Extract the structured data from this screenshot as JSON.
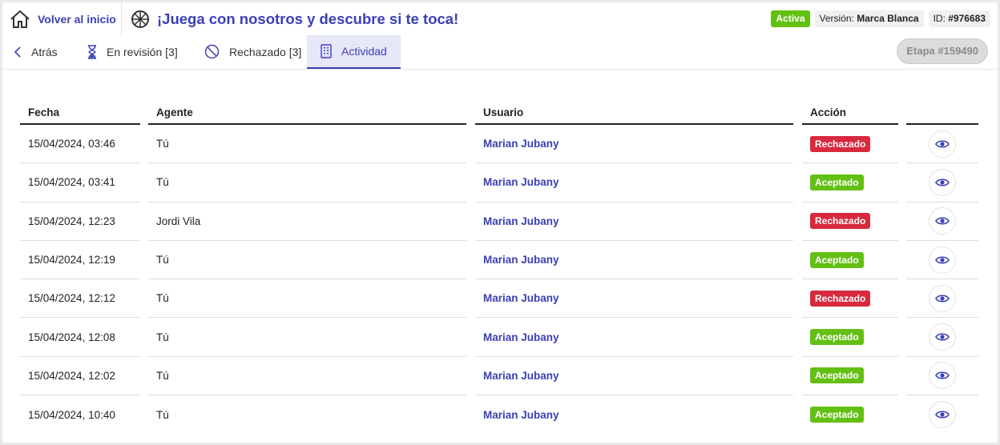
{
  "header": {
    "home_label": "Volver al inicio",
    "title": "¡Juega con nosotros y descubre si te toca!",
    "status": "Activa",
    "version_label": "Versión:",
    "version_value": "Marca Blanca",
    "id_label": "ID:",
    "id_value": "#976683"
  },
  "tabs": {
    "back": "Atrás",
    "review": "En revisión [3]",
    "rejected": "Rechazado [3]",
    "activity": "Actividad",
    "stage": "Etapa #159490"
  },
  "table": {
    "headers": {
      "fecha": "Fecha",
      "agente": "Agente",
      "usuario": "Usuario",
      "accion": "Acción"
    },
    "rows": [
      {
        "fecha": "15/04/2024, 03:46",
        "agente": "Tú",
        "usuario": "Marian Jubany",
        "accion": "Rechazado"
      },
      {
        "fecha": "15/04/2024, 03:41",
        "agente": "Tú",
        "usuario": "Marian Jubany",
        "accion": "Aceptado"
      },
      {
        "fecha": "15/04/2024, 12:23",
        "agente": "Jordi Vila",
        "usuario": "Marian Jubany",
        "accion": "Rechazado"
      },
      {
        "fecha": "15/04/2024, 12:19",
        "agente": "Tú",
        "usuario": "Marian Jubany",
        "accion": "Aceptado"
      },
      {
        "fecha": "15/04/2024, 12:12",
        "agente": "Tú",
        "usuario": "Marian Jubany",
        "accion": "Rechazado"
      },
      {
        "fecha": "15/04/2024, 12:08",
        "agente": "Tú",
        "usuario": "Marian Jubany",
        "accion": "Aceptado"
      },
      {
        "fecha": "15/04/2024, 12:02",
        "agente": "Tú",
        "usuario": "Marian Jubany",
        "accion": "Aceptado"
      },
      {
        "fecha": "15/04/2024, 10:40",
        "agente": "Tú",
        "usuario": "Marian Jubany",
        "accion": "Aceptado"
      }
    ]
  },
  "colors": {
    "accent": "#3b3fb6",
    "accepted": "#63c013",
    "rejected": "#d8293e",
    "active": "#63c013"
  },
  "icons": [
    "home-icon",
    "wheel-icon",
    "chevron-left-icon",
    "hourglass-icon",
    "ban-icon",
    "document-icon",
    "eye-icon"
  ]
}
